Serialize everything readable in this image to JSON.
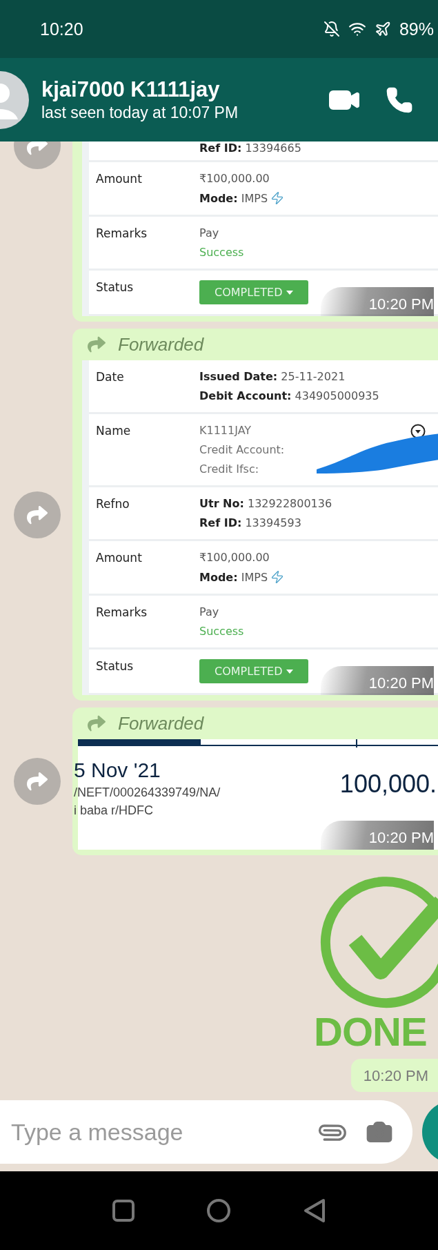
{
  "status_bar": {
    "time": "10:20",
    "battery": "89%"
  },
  "chat_header": {
    "name": "kjai7000 K1111jay",
    "subtitle": "last seen today at 10:07 PM"
  },
  "messages": [
    {
      "kind": "transfer",
      "time": "10:20 PM",
      "rows": [
        {
          "lines": [
            {
              "text": "**Ref ID:** 13394665"
            }
          ]
        },
        {
          "label": "Amount",
          "lines": [
            {
              "text": "₹100,000.00"
            },
            {
              "text": "**Mode:** IMPS",
              "bolt": true
            }
          ]
        },
        {
          "label": "Remarks",
          "lines": [
            {
              "text": "Pay"
            },
            {
              "text": "Success",
              "kind": "success"
            }
          ]
        },
        {
          "label": "Status",
          "badge": "COMPLETED"
        }
      ]
    },
    {
      "kind": "transfer",
      "forward_label": "Forwarded",
      "time": "10:20 PM",
      "rows": [
        {
          "label": "Date",
          "lines": [
            {
              "text": "**Issued Date:** 25-11-2021"
            },
            {
              "text": "**Debit Account:** 434905000935"
            }
          ]
        },
        {
          "label": "Name",
          "menu_toggle": true,
          "redacted": true,
          "lines": [
            {
              "text": "K1111JAY",
              "kind": "muted"
            },
            {
              "text": "Credit Account:",
              "kind": "muted"
            },
            {
              "text": "Credit Ifsc:",
              "kind": "muted"
            }
          ]
        },
        {
          "label": "Refno",
          "lines": [
            {
              "text": "**Utr No:** 132922800136"
            },
            {
              "text": "**Ref ID:** 13394593"
            }
          ]
        },
        {
          "label": "Amount",
          "lines": [
            {
              "text": "₹100,000.00"
            },
            {
              "text": "**Mode:** IMPS",
              "bolt": true
            }
          ]
        },
        {
          "label": "Remarks",
          "lines": [
            {
              "text": "Pay"
            },
            {
              "text": "Success",
              "kind": "success"
            }
          ]
        },
        {
          "label": "Status",
          "badge": "COMPLETED"
        }
      ]
    },
    {
      "kind": "statement",
      "forward_label": "Forwarded",
      "date": "5 Nov '21",
      "lines": [
        "/NEFT/000264339749/NA/",
        "i baba r/HDFC"
      ],
      "amount": "100,000.",
      "time": "10:20 PM"
    },
    {
      "kind": "sticker",
      "caption": "DONE",
      "time": "10:20 PM"
    }
  ],
  "composer": {
    "placeholder": "Type a message"
  }
}
